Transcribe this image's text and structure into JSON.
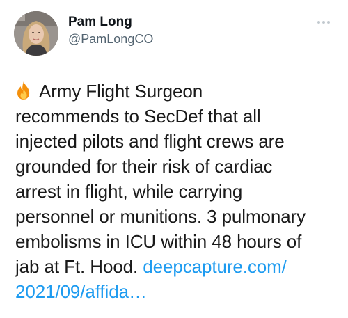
{
  "tweet": {
    "author": {
      "display_name": "Pam Long",
      "handle": "@PamLongCO",
      "avatar_icon": "profile-photo"
    },
    "more_icon": "more-options-icon",
    "emoji": "fire",
    "text_lines": [
      "Army Flight Surgeon",
      "recommends to SecDef that all",
      "injected pilots and flight crews are",
      "grounded for their risk of cardiac",
      "arrest in flight, while carrying",
      "personnel or munitions. 3 pulmonary",
      "embolisms in ICU within 48 hours of",
      "jab at Ft. Hood."
    ],
    "link_line1": "deepcapture.com/",
    "link_line2": "2021/09/affida…"
  },
  "colors": {
    "text": "#1a1a1a",
    "secondary": "#536471",
    "link": "#1d9bf0",
    "more_dots": "#c2c9cf"
  }
}
